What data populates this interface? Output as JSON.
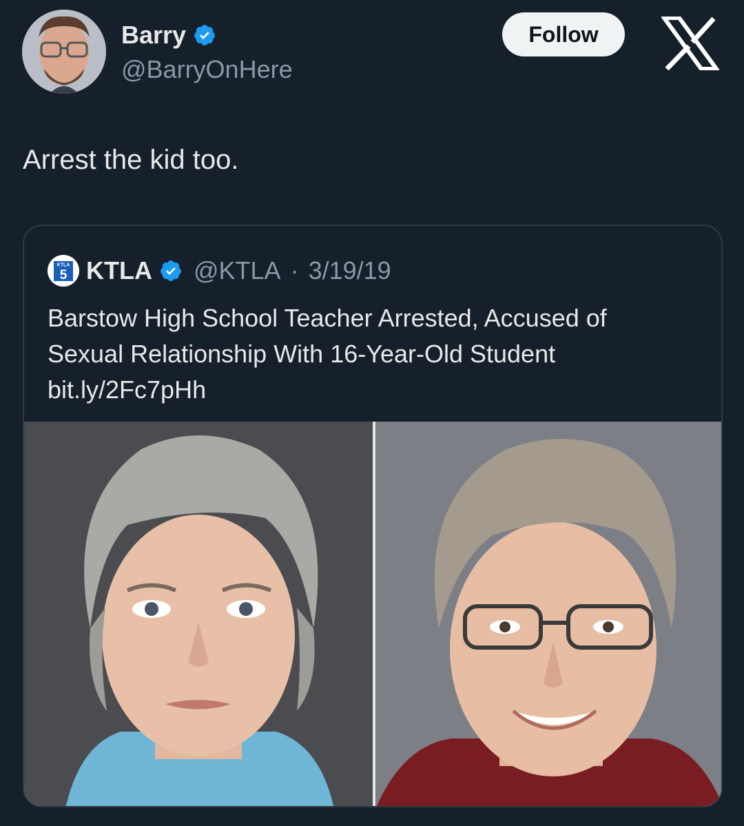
{
  "author": {
    "name": "Barry",
    "handle": "@BarryOnHere",
    "verified_color": "#1d9bf0"
  },
  "follow_label": "Follow",
  "platform_icon": "x-logo-icon",
  "tweet_text": "Arrest the kid too.",
  "quoted": {
    "logo_text": "KTLA",
    "logo_number": "5",
    "name": "KTLA",
    "handle": "@KTLA",
    "separator": "·",
    "date": "3/19/19",
    "text_line1": "Barstow High School Teacher Arrested, Accused of",
    "text_line2": "Sexual Relationship With 16-Year-Old Student",
    "link": "bit.ly/2Fc7pHh"
  }
}
